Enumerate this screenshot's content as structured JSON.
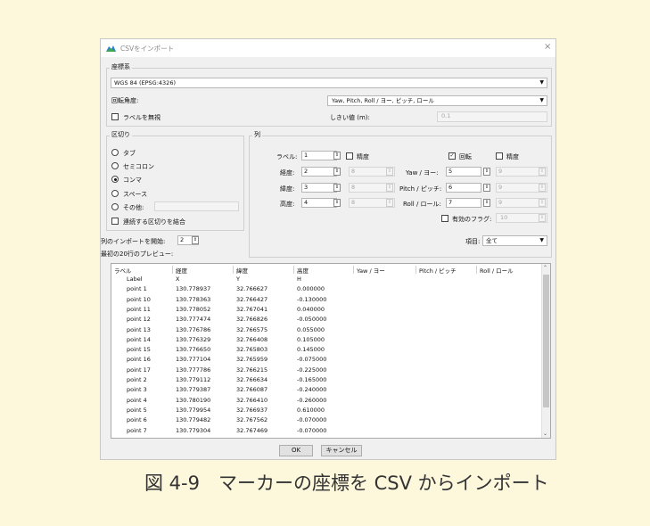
{
  "dialog": {
    "title": "CSVをインポート",
    "close_glyph": "×",
    "crs_group_label": "座標系",
    "crs_value": "WGS 84 (EPSG:4326)",
    "rotation_label": "回転角度:",
    "rotation_value": "Yaw, Pitch, Roll / ヨー, ピッチ, ロール",
    "ignore_labels": "ラベルを無視",
    "threshold_label": "しきい値 (m):",
    "threshold_value": "0.1",
    "delimiter_group": "区切り",
    "delimiters": [
      "タブ",
      "セミコロン",
      "コンマ",
      "スペース",
      "その他:"
    ],
    "delimiter_selected": "コンマ",
    "merge_delimiters": "連続する区切りを結合",
    "columns_group": "列",
    "label_label": "ラベル:",
    "label_value": "1",
    "accuracy_label": "精度",
    "rotation_check_label": "回転",
    "rotation_accuracy_label": "精度",
    "longitude_label": "経度:",
    "latitude_label": "緯度:",
    "altitude_label": "高度:",
    "yaw_label": "Yaw / ヨー:",
    "pitch_label": "Pitch / ピッチ:",
    "roll_label": "Roll / ロール:",
    "enable_flag_label": "有効のフラグ:",
    "enable_flag_value": "10",
    "start_row_label": "列のインポートを開始:",
    "start_row_value": "2",
    "items_label": "項目:",
    "items_value": "全て",
    "preview_label": "最初の20行のプレビュー:",
    "ok_label": "OK",
    "cancel_label": "キャンセル"
  },
  "column_rows": [
    {
      "value": "2",
      "acc": "8",
      "rot": "5",
      "rot_acc": "9"
    },
    {
      "value": "3",
      "acc": "8",
      "rot": "6",
      "rot_acc": "9"
    },
    {
      "value": "4",
      "acc": "8",
      "rot": "7",
      "rot_acc": "9"
    }
  ],
  "preview": {
    "headers": [
      "ラベル",
      "経度",
      "緯度",
      "高度",
      "Yaw / ヨー",
      "Pitch / ピッチ",
      "Roll / ロール"
    ],
    "rows": [
      [
        "Label",
        "X",
        "Y",
        "H"
      ],
      [
        "point 1",
        "130.778937",
        "32.766627",
        "0.000000"
      ],
      [
        "point 10",
        "130.778363",
        "32.766427",
        "-0.130000"
      ],
      [
        "point 11",
        "130.778052",
        "32.767041",
        "0.040000"
      ],
      [
        "point 12",
        "130.777474",
        "32.766826",
        "-0.050000"
      ],
      [
        "point 13",
        "130.776786",
        "32.766575",
        "0.055000"
      ],
      [
        "point 14",
        "130.776329",
        "32.766408",
        "0.105000"
      ],
      [
        "point 15",
        "130.776650",
        "32.765803",
        "0.145000"
      ],
      [
        "point 16",
        "130.777104",
        "32.765959",
        "-0.075000"
      ],
      [
        "point 17",
        "130.777786",
        "32.766215",
        "-0.225000"
      ],
      [
        "point 2",
        "130.779112",
        "32.766634",
        "-0.165000"
      ],
      [
        "point 3",
        "130.779387",
        "32.766087",
        "-0.240000"
      ],
      [
        "point 4",
        "130.780190",
        "32.766410",
        "-0.260000"
      ],
      [
        "point 5",
        "130.779954",
        "32.766937",
        "0.610000"
      ],
      [
        "point 6",
        "130.779482",
        "32.767562",
        "-0.070000"
      ],
      [
        "point 7",
        "130.779304",
        "32.767469",
        "-0.070000"
      ]
    ]
  },
  "caption": "図 4-9　マーカーの座標を CSV からインポート",
  "icons": {
    "app": "metashape-app-icon",
    "spin": "spin-arrows-icon"
  }
}
